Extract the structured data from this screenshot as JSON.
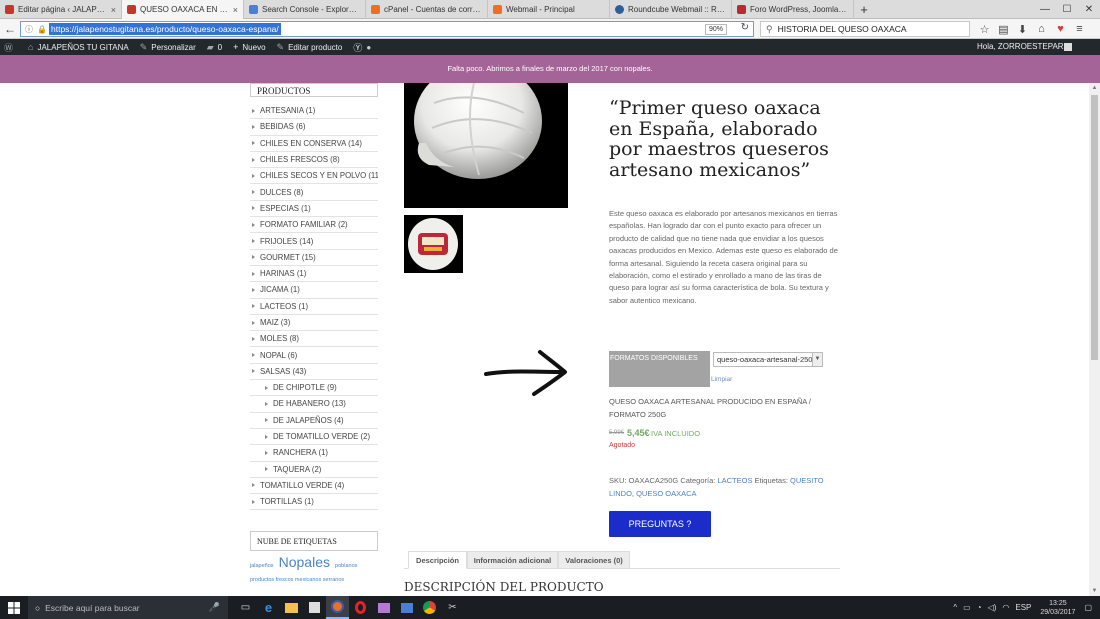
{
  "browser": {
    "tabs": [
      {
        "title": "Editar página ‹ JALAPEÑO...",
        "icon": "wp-pepper-icon",
        "active": false
      },
      {
        "title": "QUESO OAXACA EN ESPA...",
        "icon": "wp-pepper-icon",
        "active": true
      },
      {
        "title": "Search Console - Explorar ...",
        "icon": "search-console-icon",
        "active": false
      },
      {
        "title": "cPanel - Cuentas de corre...",
        "icon": "cpanel-icon",
        "active": false
      },
      {
        "title": "Webmail - Principal",
        "icon": "cpanel-icon",
        "active": false
      },
      {
        "title": "Roundcube Webmail :: Re...",
        "icon": "roundcube-icon",
        "active": false
      },
      {
        "title": "Foro WordPress, Joomla y ...",
        "icon": "forum-icon",
        "active": false
      }
    ],
    "url": "https://jalapenostugitana.es/producto/queso-oaxaca-espana/",
    "zoom": "90%",
    "search_text": "HISTORIA DEL QUESO OAXACA"
  },
  "wp_admin": {
    "site_name": "JALAPEÑOS TU GITANA",
    "customize": "Personalizar",
    "comments": "0",
    "new": "Nuevo",
    "edit_product": "Editar producto",
    "greeting": "Hola, ZORROESTEPARIO"
  },
  "notice": "Falta poco. Abrimos a finales de marzo del 2017 con nopales.",
  "sidebar": {
    "title": "PRODUCTOS",
    "categories": [
      {
        "label": "ARTESANIA (1)",
        "sub": false
      },
      {
        "label": "BEBIDAS (6)",
        "sub": false
      },
      {
        "label": "CHILES EN CONSERVA (14)",
        "sub": false
      },
      {
        "label": "CHILES FRESCOS (8)",
        "sub": false
      },
      {
        "label": "CHILES SECOS Y EN POLVO (11)",
        "sub": false
      },
      {
        "label": "DULCES (8)",
        "sub": false
      },
      {
        "label": "ESPECIAS (1)",
        "sub": false
      },
      {
        "label": "FORMATO FAMILIAR (2)",
        "sub": false
      },
      {
        "label": "FRIJOLES (14)",
        "sub": false
      },
      {
        "label": "GOURMET (15)",
        "sub": false
      },
      {
        "label": "HARINAS (1)",
        "sub": false
      },
      {
        "label": "JICAMA (1)",
        "sub": false
      },
      {
        "label": "LACTEOS (1)",
        "sub": false
      },
      {
        "label": "MAIZ (3)",
        "sub": false
      },
      {
        "label": "MOLES (8)",
        "sub": false
      },
      {
        "label": "NOPAL (6)",
        "sub": false
      },
      {
        "label": "SALSAS (43)",
        "sub": false
      },
      {
        "label": "DE CHIPOTLE (9)",
        "sub": true
      },
      {
        "label": "DE HABANERO (13)",
        "sub": true
      },
      {
        "label": "DE JALAPEÑOS (4)",
        "sub": true
      },
      {
        "label": "DE TOMATILLO VERDE (2)",
        "sub": true
      },
      {
        "label": "RANCHERA (1)",
        "sub": true
      },
      {
        "label": "TAQUERA (2)",
        "sub": true
      },
      {
        "label": "TOMATILLO VERDE (4)",
        "sub": false
      },
      {
        "label": "TORTILLAS (1)",
        "sub": false
      }
    ],
    "tags_title": "NUBE DE ETIQUETAS",
    "tags": {
      "jalapenos": "jalapeños",
      "nopales": "Nopales",
      "poblanos": "poblanos",
      "line2": "productos frescos mexicanos serranos"
    }
  },
  "product": {
    "title": "“Primer queso oaxaca en España, elaborado por maestros queseros artesano mexicanos”",
    "description": "Este queso oaxaca es elaborado por artesanos mexicanos en tierras españolas. Han logrado dar con el punto exacto para ofrecer un producto de calidad que no tiene nada que envidiar a los quesos oaxacas producidos en Mexico. Ademas este queso es elaborado de forma artesanal. Siguiendo la receta casera original para su elaboración, como el estirado y enrollado a mano de las tiras de queso para lograr así su forma característica de bola. Su textura y sabor autentico mexicano.",
    "formats_label": "FORMATOS DISPONIBLES",
    "format_selected": "queso-oaxaca-artesanal-250",
    "clear": "Limpiar",
    "variation_name": "QUESO OAXACA ARTESANAL PRODUCIDO EN ESPAÑA / FORMATO 250G",
    "old_price": "5,99€",
    "new_price": "5,45€",
    "iva": "IVA INCLUIDO",
    "stock": "Agotado",
    "sku_label": "SKU:",
    "sku": "OAXACA250G",
    "category_label": "Categoría:",
    "category": "LACTEOS",
    "tags_label": "Etiquetas:",
    "tag1": "QUESITO LINDO",
    "tag2": "QUESO OAXACA",
    "button": "PREGUNTAS ?",
    "tabs": [
      "Descripción",
      "Información adicional",
      "Valoraciones (0)"
    ],
    "desc_heading": "DESCRIPCIÓN DEL PRODUCTO"
  },
  "taskbar": {
    "search_placeholder": "Escribe aquí para buscar",
    "lang": "ESP",
    "time": "13:25",
    "date": "29/03/2017"
  },
  "colors": {
    "notice_bg": "#a46497",
    "button_bg": "#1b2ccb",
    "price_green": "#6eaa5e",
    "stock_red": "#d43c3c",
    "link_blue": "#4a84c4"
  }
}
